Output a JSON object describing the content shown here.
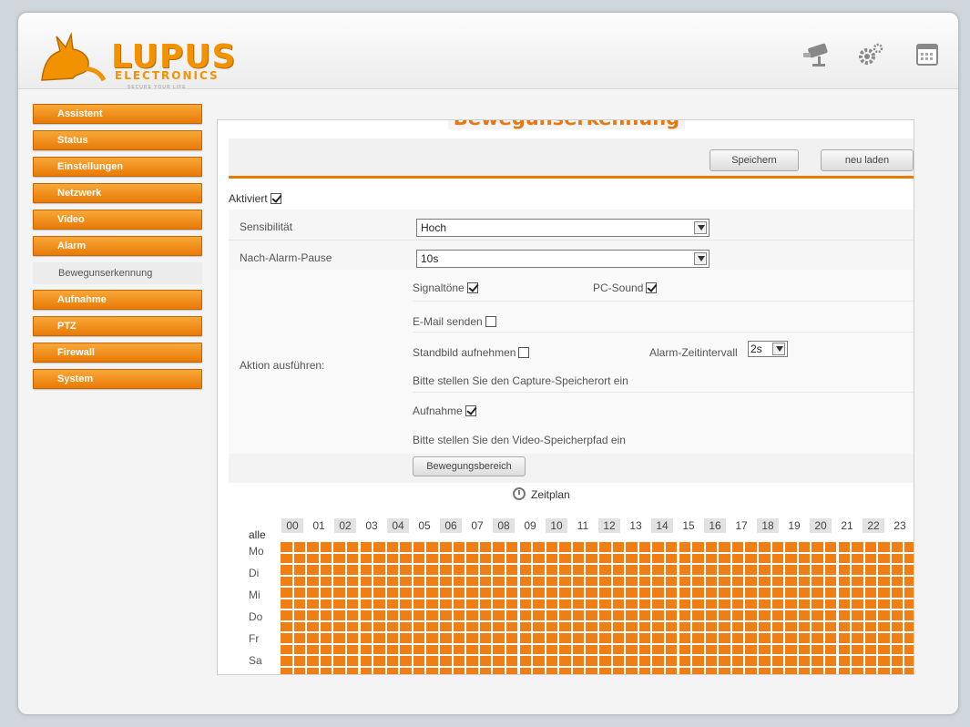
{
  "brand": {
    "name": "LUPUS",
    "sub": "ELECTRONICS",
    "slogan": "SECURE YOUR LIFE",
    "accent": "#f39200"
  },
  "header_icons": [
    "camera-icon",
    "settings-gears-icon",
    "calendar-icon"
  ],
  "sidebar": {
    "items": [
      {
        "label": "Assistent"
      },
      {
        "label": "Status"
      },
      {
        "label": "Einstellungen"
      },
      {
        "label": "Netzwerk"
      },
      {
        "label": "Video"
      },
      {
        "label": "Alarm"
      },
      {
        "label": "Bewegunserkennung",
        "sub": true,
        "active": true
      },
      {
        "label": "Aufnahme"
      },
      {
        "label": "PTZ"
      },
      {
        "label": "Firewall"
      },
      {
        "label": "System"
      }
    ]
  },
  "page": {
    "title": "Bewegunserkennung",
    "save_label": "Speichern",
    "reload_label": "neu laden"
  },
  "form": {
    "enabled_label": "Aktiviert",
    "enabled": true,
    "sensitivity_label": "Sensibilität",
    "sensitivity_value": "Hoch",
    "pause_label": "Nach-Alarm-Pause",
    "pause_value": "10s",
    "action_label": "Aktion ausführen:",
    "signal_label": "Signaltöne",
    "signal": true,
    "pcsound_label": "PC-Sound",
    "pcsound": true,
    "email_label": "E-Mail senden",
    "email": false,
    "snapshot_label": "Standbild aufnehmen",
    "snapshot": false,
    "interval_label": "Alarm-Zeitintervall",
    "interval_value": "2s",
    "capture_hint": "Bitte stellen Sie den Capture-Speicherort ein",
    "record_label": "Aufnahme",
    "record": true,
    "video_hint": "Bitte stellen Sie den Video-Speicherpfad ein",
    "area_button": "Bewegungsbereich"
  },
  "schedule": {
    "title": "Zeitplan",
    "all_label": "alle",
    "hours": [
      "00",
      "01",
      "02",
      "03",
      "04",
      "05",
      "06",
      "07",
      "08",
      "09",
      "10",
      "11",
      "12",
      "13",
      "14",
      "15",
      "16",
      "17",
      "18",
      "19",
      "20",
      "21",
      "22",
      "23"
    ],
    "days": [
      "Mo",
      "Di",
      "Mi",
      "Do",
      "Fr",
      "Sa"
    ],
    "color": "#ef7f14"
  }
}
